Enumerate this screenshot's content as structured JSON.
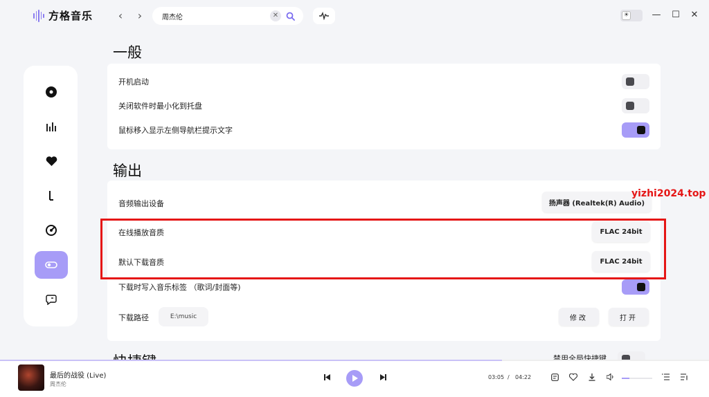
{
  "app": {
    "name": "方格音乐"
  },
  "search": {
    "value": "周杰伦",
    "clear_icon": "close-icon",
    "search_icon": "search-icon"
  },
  "colors": {
    "accent": "#a79cf7",
    "highlight": "#e51616",
    "toggle_off": "#f0f0f3"
  },
  "sidebar": {
    "items": [
      {
        "name": "disc-icon",
        "active": false
      },
      {
        "name": "chart-bars-icon",
        "active": false
      },
      {
        "name": "heart-icon",
        "active": false
      },
      {
        "name": "music-note-icon",
        "active": false
      },
      {
        "name": "radar-icon",
        "active": false
      },
      {
        "name": "settings-toggle-icon",
        "active": true
      },
      {
        "name": "chat-bubble-icon",
        "active": false
      }
    ]
  },
  "settings": {
    "general": {
      "title": "一般",
      "rows": [
        {
          "label": "开机启动",
          "on": false
        },
        {
          "label": "关闭软件时最小化到托盘",
          "on": false
        },
        {
          "label": "鼠标移入显示左侧导航栏提示文字",
          "on": true
        }
      ]
    },
    "output": {
      "title": "输出",
      "device_label": "音频输出设备",
      "device_value": "扬声器 (Realtek(R) Audio)",
      "online_quality_label": "在线播放音质",
      "online_quality_value": "FLAC 24bit",
      "download_quality_label": "默认下载音质",
      "download_quality_value": "FLAC 24bit",
      "write_tags_label": "下载时写入音乐标签 （歌词/封面等)",
      "write_tags_on": true,
      "path_label": "下载路径",
      "path_value": "E:\\music",
      "modify_label": "修改",
      "open_label": "打开"
    },
    "shortcuts": {
      "title": "快捷键",
      "global_label": "禁用全局快捷键",
      "global_on": false
    }
  },
  "watermark": "yizhi2024.top",
  "player": {
    "title": "最后的战役 (Live)",
    "artist": "周杰伦",
    "current_time": "03:05",
    "separator": "/",
    "total_time": "04:22",
    "progress": 0.708,
    "volume": 0.25
  }
}
